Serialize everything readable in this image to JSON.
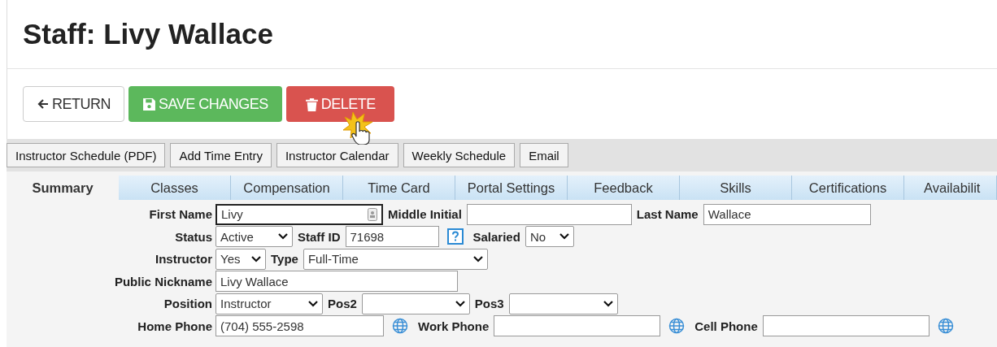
{
  "title": "Staff: Livy Wallace",
  "actions": [
    {
      "label": "RETURN",
      "kind": "return"
    },
    {
      "label": "SAVE CHANGES",
      "kind": "save"
    },
    {
      "label": "DELETE",
      "kind": "delete"
    }
  ],
  "toolbar": [
    "Instructor Schedule (PDF)",
    "Add Time Entry",
    "Instructor Calendar",
    "Weekly Schedule",
    "Email"
  ],
  "tabs": [
    {
      "label": "Summary",
      "selected": true
    },
    {
      "label": "Classes",
      "selected": false
    },
    {
      "label": "Compensation",
      "selected": false
    },
    {
      "label": "Time Card",
      "selected": false
    },
    {
      "label": "Portal Settings",
      "selected": false
    },
    {
      "label": "Feedback",
      "selected": false
    },
    {
      "label": "Skills",
      "selected": false
    },
    {
      "label": "Certifications",
      "selected": false
    },
    {
      "label": "Availabilit",
      "selected": false
    }
  ],
  "form": [
    {
      "label": "First Name",
      "fields": [
        {
          "kind": "input",
          "value": "Livy",
          "focused": true
        },
        {
          "kind": "label",
          "text": "Middle Initial"
        },
        {
          "kind": "input"
        },
        {
          "kind": "label",
          "text": "Last Name"
        },
        {
          "kind": "input",
          "value": "Wallace"
        }
      ]
    },
    {
      "label": "Status",
      "fields": [
        {
          "kind": "select",
          "value": "Active"
        },
        {
          "kind": "label",
          "text": "Staff ID"
        },
        {
          "kind": "input",
          "value": "71698"
        },
        {
          "kind": "help"
        },
        {
          "kind": "label",
          "text": "Salaried"
        },
        {
          "kind": "select",
          "value": "No"
        }
      ]
    },
    {
      "label": "Instructor",
      "fields": [
        {
          "kind": "select",
          "value": "Yes"
        },
        {
          "kind": "label",
          "text": "Type"
        },
        {
          "kind": "select",
          "value": "Full-Time"
        }
      ]
    },
    {
      "label": "Public Nickname",
      "fields": [
        {
          "kind": "input",
          "value": "Livy Wallace"
        }
      ]
    },
    {
      "label": "Position",
      "fields": [
        {
          "kind": "select",
          "value": "Instructor"
        },
        {
          "kind": "label",
          "text": "Pos2"
        },
        {
          "kind": "select"
        },
        {
          "kind": "label",
          "text": "Pos3"
        },
        {
          "kind": "select"
        }
      ]
    },
    {
      "label": "Home Phone",
      "fields": [
        {
          "kind": "input",
          "value": "(704) 555-2598"
        },
        {
          "kind": "globe"
        },
        {
          "kind": "label",
          "text": "Work Phone"
        },
        {
          "kind": "input"
        },
        {
          "kind": "globe"
        },
        {
          "kind": "label",
          "text": "Cell Phone"
        },
        {
          "kind": "input"
        },
        {
          "kind": "globe"
        }
      ]
    }
  ]
}
